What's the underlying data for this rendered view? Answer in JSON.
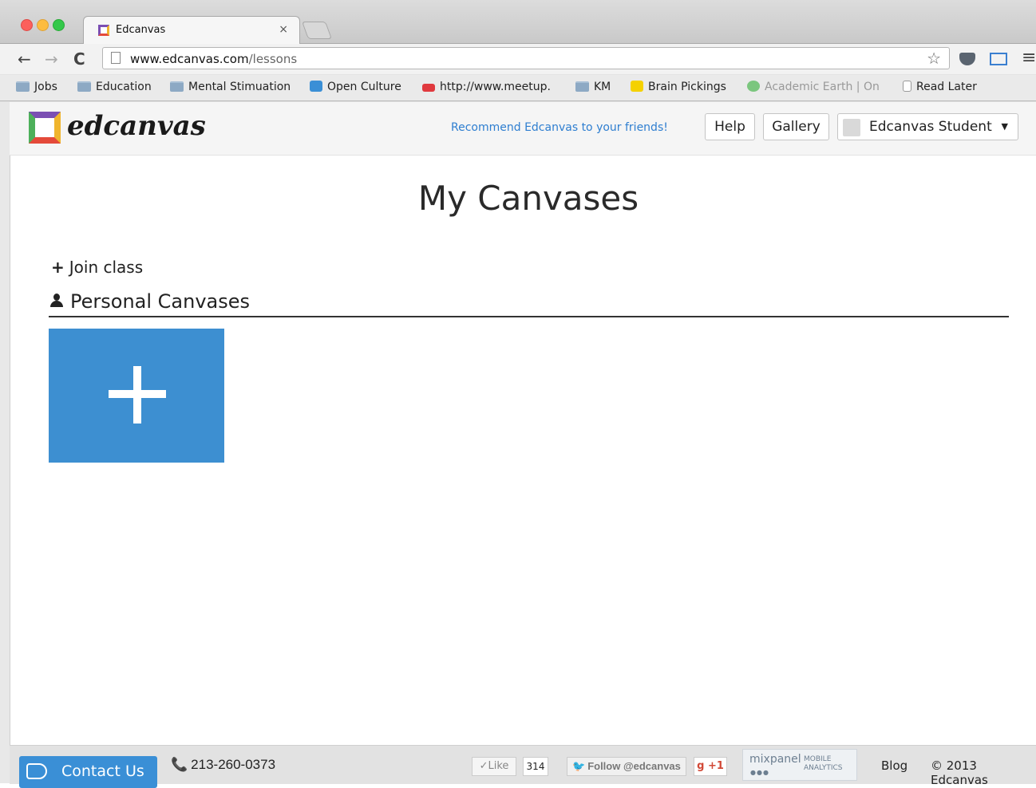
{
  "browser": {
    "tab": {
      "title": "Edcanvas",
      "close": "×"
    },
    "nav": {
      "back": "←",
      "forward": "→",
      "reload": "C"
    },
    "url": {
      "host": "www.edcanvas.com",
      "path": "/lessons"
    },
    "icons": {
      "star": "☆",
      "menu": "≡"
    },
    "bookmarks": [
      {
        "label": "Jobs",
        "icon": "folder-icon"
      },
      {
        "label": "Education",
        "icon": "folder-icon"
      },
      {
        "label": "Mental Stimuation",
        "icon": "folder-icon"
      },
      {
        "label": "Open Culture",
        "icon": "open-culture-icon"
      },
      {
        "label": "http://www.meetup.",
        "icon": "meetup-icon"
      },
      {
        "label": "KM",
        "icon": "folder-icon"
      },
      {
        "label": "Brain Pickings",
        "icon": "brain-pickings-icon"
      },
      {
        "label": "Academic Earth | On",
        "icon": "globe-icon"
      },
      {
        "label": "Read Later",
        "icon": "page-icon"
      }
    ]
  },
  "header": {
    "logo_text": "edcanvas",
    "recommend": "Recommend Edcanvas to your friends!",
    "help": "Help",
    "gallery": "Gallery",
    "user_name": "Edcanvas Student",
    "caret": "▼"
  },
  "main": {
    "title": "My Canvases",
    "join_plus": "+",
    "join_class": "Join class",
    "personal_heading": "Personal Canvases"
  },
  "footer": {
    "contact": "Contact Us",
    "phone_icon": "📞",
    "phone": "213-260-0373",
    "like": "✓Like",
    "like_count": "314",
    "follow_bird": "🐦",
    "follow": "Follow @edcanvas",
    "gplus": "g +1",
    "mixpanel_name": "mixpanel",
    "mixpanel_sub1": "MOBILE",
    "mixpanel_sub2": "ANALYTICS",
    "blog": "Blog",
    "copyright": "© 2013 Edcanvas"
  },
  "colors": {
    "accent_blue": "#3d8fd1",
    "link_blue": "#2e7ed0"
  }
}
